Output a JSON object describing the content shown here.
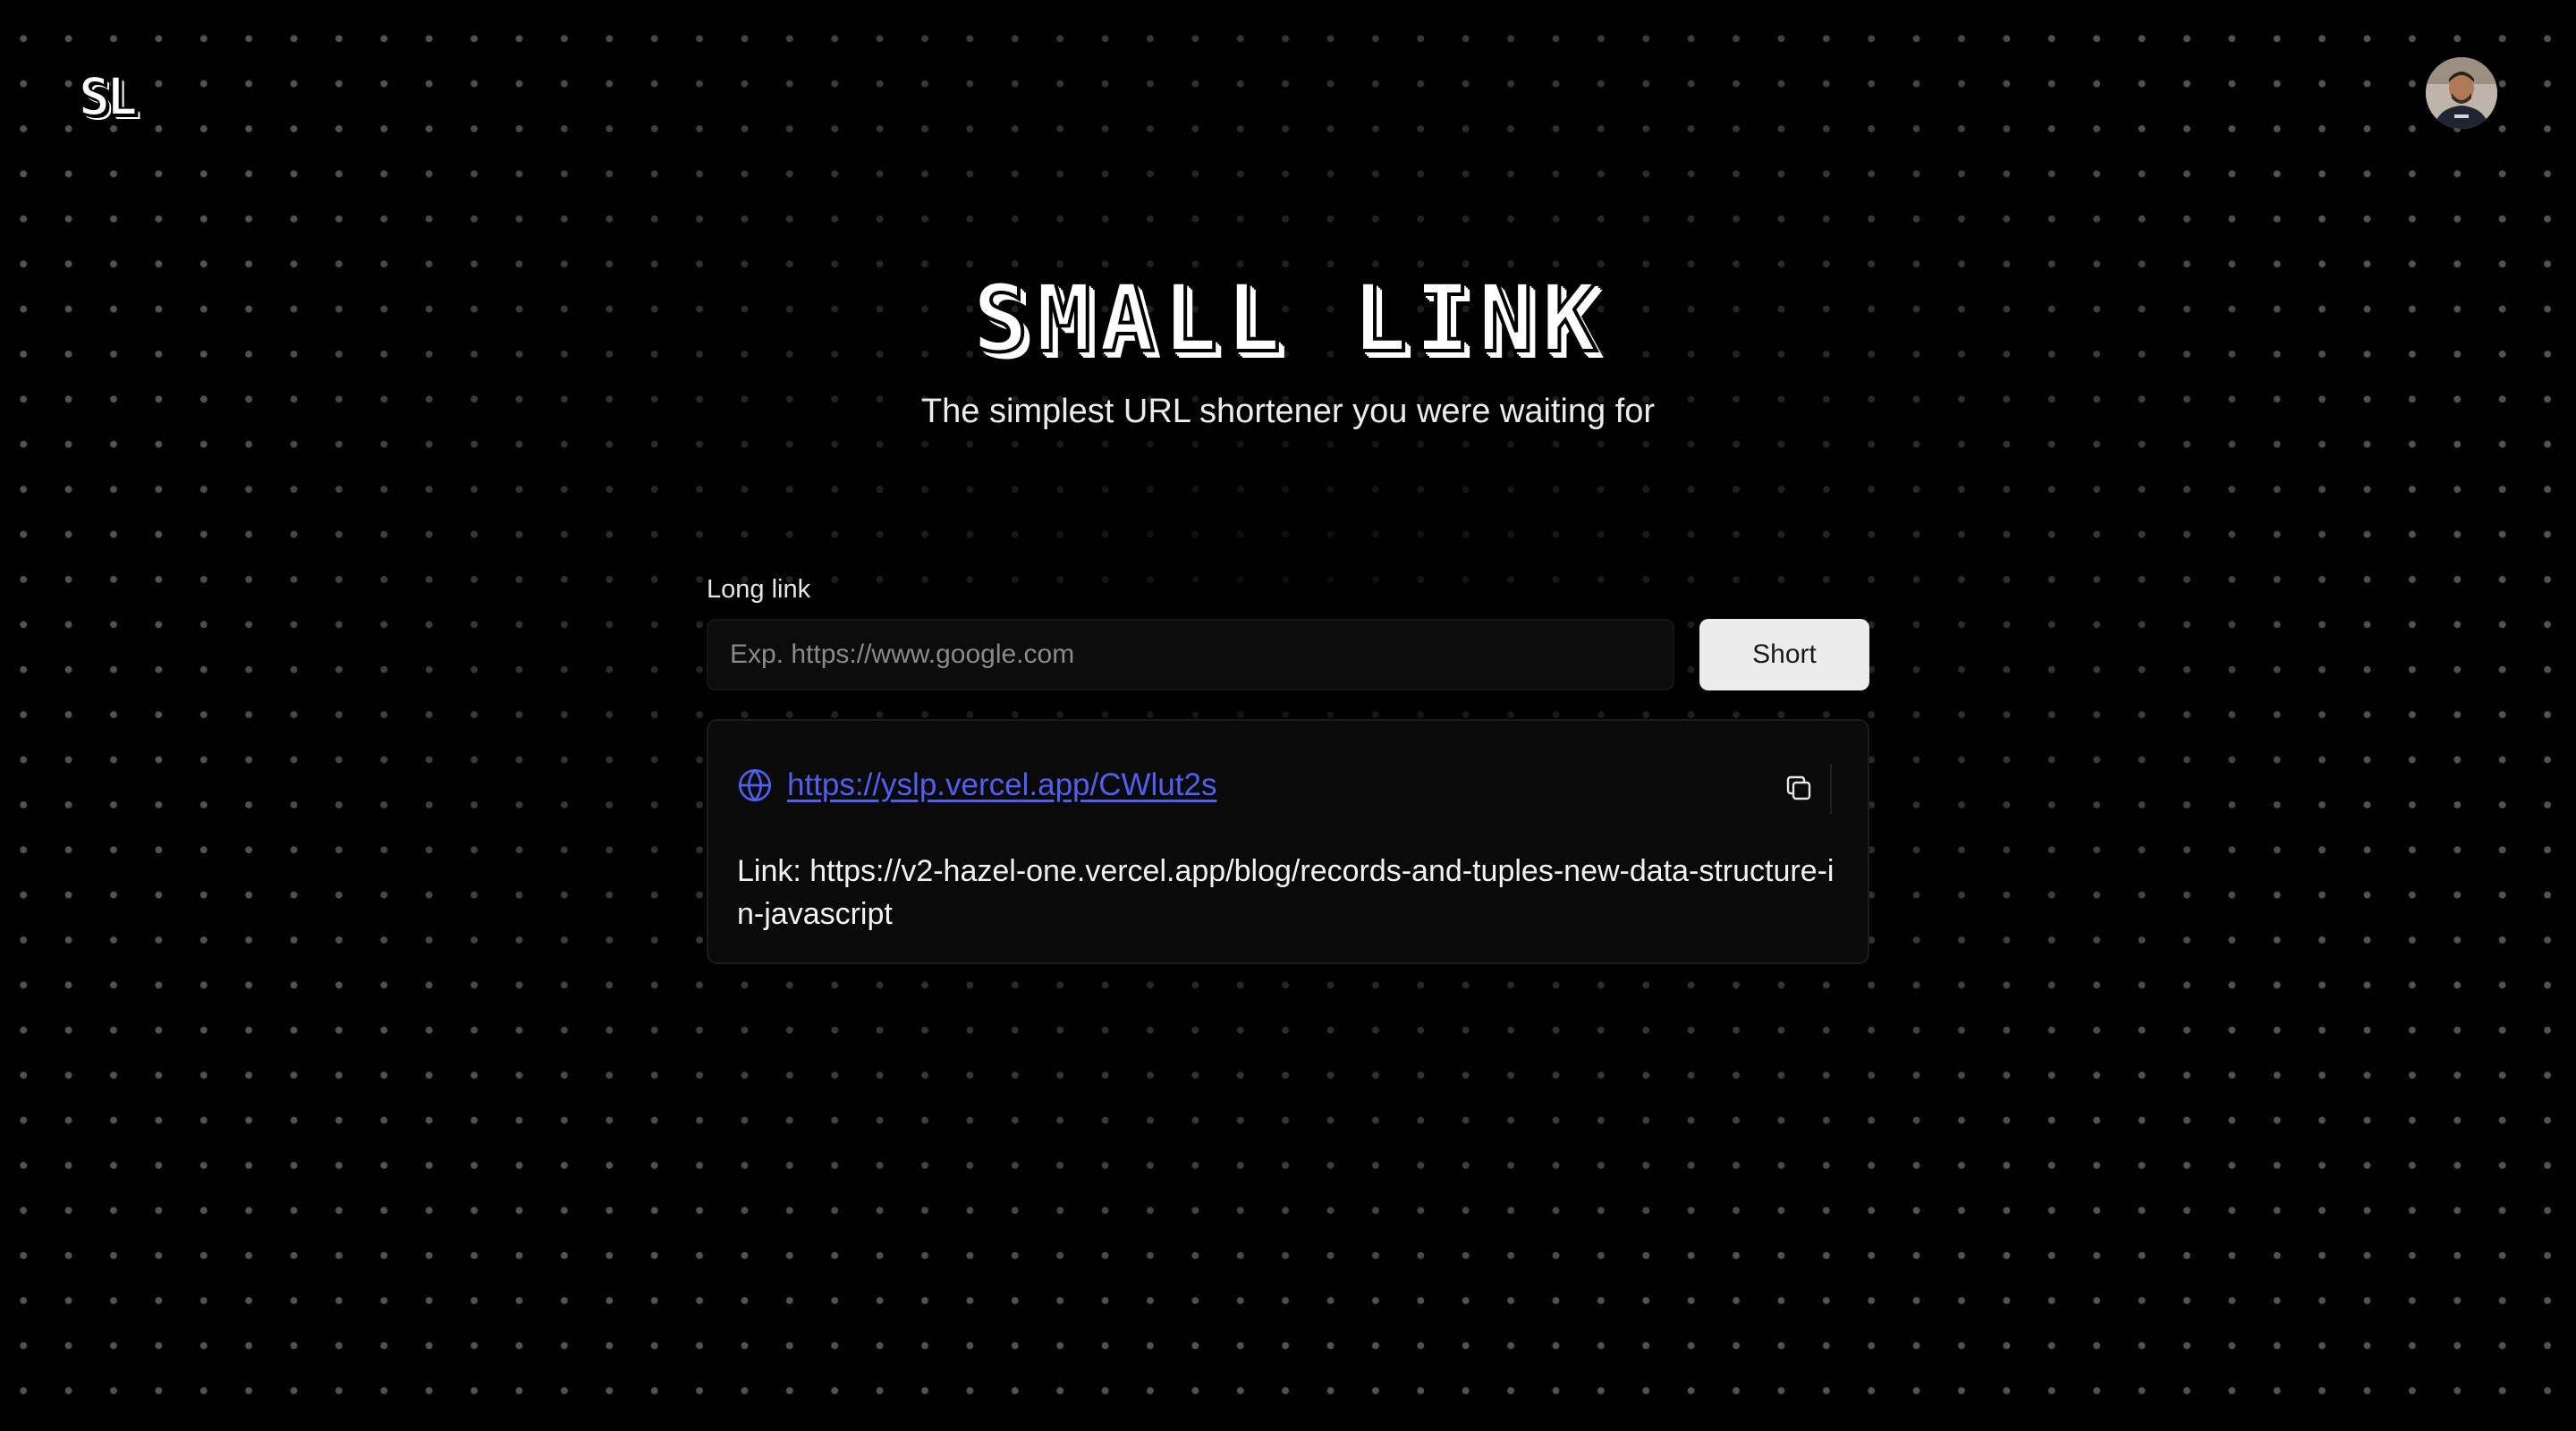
{
  "header": {
    "logo_text": "SL",
    "avatar_alt": "User avatar"
  },
  "hero": {
    "title": "SMALL LINK",
    "subtitle": "The simplest URL shortener you were waiting for"
  },
  "form": {
    "label": "Long link",
    "input_placeholder": "Exp. https://www.google.com",
    "input_value": "",
    "button_label": "Short"
  },
  "result": {
    "short_url": "https://yslp.vercel.app/CWlut2s",
    "original_label": "Link: https://v2-hazel-one.vercel.app/blog/records-and-tuples-new-data-structure-in-javascript",
    "icons": {
      "link_icon": "globe-icon",
      "copy_icon": "copy-icon"
    }
  },
  "colors": {
    "background": "#000000",
    "dot": "#969696",
    "link": "#4f5ff0",
    "button_bg": "#ececec",
    "card_bg": "#0a0a0a"
  }
}
